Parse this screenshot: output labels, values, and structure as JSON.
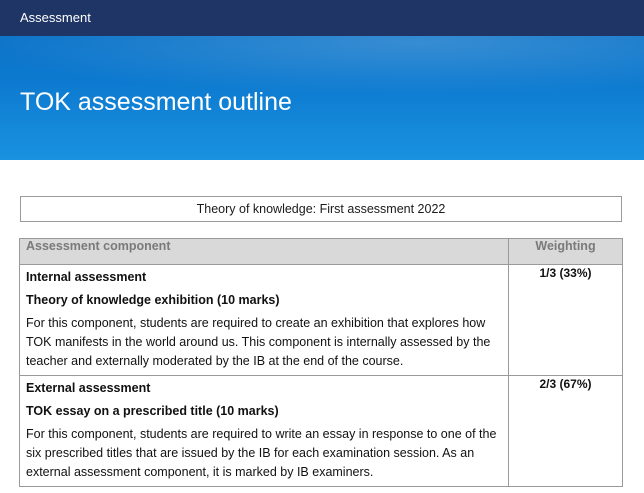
{
  "topbar": {
    "label": "Assessment"
  },
  "banner": {
    "title": "TOK assessment outline"
  },
  "subject_line": "Theory of knowledge: First assessment 2022",
  "table": {
    "headers": {
      "component": "Assessment component",
      "weighting": "Weighting"
    },
    "rows": [
      {
        "heading": "Internal assessment",
        "subheading": "Theory of knowledge exhibition (10 marks)",
        "description": "For this component, students are required to create an exhibition that explores how TOK manifests in the world around us. This component is internally assessed by the teacher and externally moderated by the IB at the end of the course.",
        "weighting": "1/3 (33%)"
      },
      {
        "heading": "External assessment",
        "subheading": "TOK essay on a prescribed title (10 marks)",
        "description": "For this component, students are required to write an essay in response to one of the six prescribed titles that are issued by the IB for each examination session. As an external assessment component, it is marked by IB examiners.",
        "weighting": "2/3 (67%)"
      }
    ]
  },
  "colors": {
    "topbar": "#1f3565",
    "banner": "#0c79cf",
    "header_bg": "#d9d9d9"
  }
}
